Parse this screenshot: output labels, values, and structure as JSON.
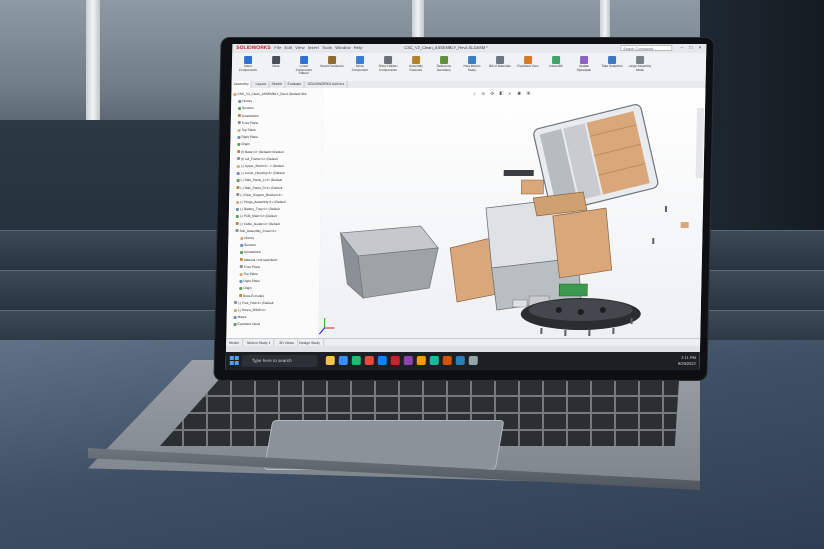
{
  "app": {
    "brand": "SOLIDWORKS",
    "menu": [
      "File",
      "Edit",
      "View",
      "Insert",
      "Tools",
      "Window",
      "Help"
    ],
    "document_title": "CSC_V2_Clean_ASSEMBLY_Rev4.SLDASM *",
    "search_placeholder": "Search Commands",
    "brand_color": "#c0262d"
  },
  "ribbon": {
    "buttons": [
      {
        "label": "Insert Components",
        "color": "#2e6fd8"
      },
      {
        "label": "Mate",
        "color": "#4a4f55"
      },
      {
        "label": "Linear Component Pattern",
        "color": "#2e6fd8"
      },
      {
        "label": "Smart Fasteners",
        "color": "#8f6b2a"
      },
      {
        "label": "Move Component",
        "color": "#3b7ecf"
      },
      {
        "label": "Show Hidden Components",
        "color": "#6a7078"
      },
      {
        "label": "Assembly Features",
        "color": "#b4832e"
      },
      {
        "label": "Reference Geometry",
        "color": "#5f8f3a"
      },
      {
        "label": "New Motion Study",
        "color": "#3c7fbf"
      },
      {
        "label": "Bill of Materials",
        "color": "#6b7580"
      },
      {
        "label": "Exploded View",
        "color": "#d57a1f"
      },
      {
        "label": "Instant3D",
        "color": "#3fa36a"
      },
      {
        "label": "Update Speedpak",
        "color": "#8a63c4"
      },
      {
        "label": "Take Snapshot",
        "color": "#3f79c2"
      },
      {
        "label": "Large Assembly Mode",
        "color": "#7a8089"
      }
    ]
  },
  "tabs": [
    "Assembly",
    "Layout",
    "Sketch",
    "Evaluate",
    "SOLIDWORKS Add-Ins"
  ],
  "tree": {
    "items": [
      "CSC_V2_Clean_ASSEMBLY_Rev4 (Default<Dis",
      "History",
      "Sensors",
      "Annotations",
      "Front Plane",
      "Top Plane",
      "Right Plane",
      "Origin",
      "(f) Base<1> (Default<<Default",
      "(f) Lid_Frame<1> (Default",
      "(-) Upper_Shell<1> -> (Default",
      "(-) Lower_Housing<1> (Default",
      "(-) Side_Panel_L<1> (Default",
      "(-) Side_Panel_R<1> (Default",
      "(-) Rear_Support_Bracket<1>",
      "(-) Hinge_Assembly<1> (Default",
      "(-) Battery_Tray<1> (Default",
      "(-) PCB_Main<1> (Default",
      "(-) Cable_Guide<1> (Default",
      "Sub_Assembly_Cover<1>",
      "History",
      "Sensors",
      "Annotations",
      "Material <not specified>",
      "Front Plane",
      "Top Plane",
      "Right Plane",
      "Origin",
      "Boss-Extrude1",
      "(-) Foot_Pad<1> (Default",
      "(-) Screw_M3x8<1>",
      "Mates",
      "Exploded Views"
    ]
  },
  "viewport": {
    "heads_up_glyphs": "⌕ ⊕ ✥ ◧ ◐ ◉ ▣",
    "background_top": "#ffffff",
    "part_colors": {
      "beige_panels": "#d9a77a",
      "grey_shell": "#a9aeb3",
      "dark_base": "#2a2c30",
      "green_pcb": "#3c9a4e"
    }
  },
  "bottom_tabs": [
    "Model",
    "Motion Study 1",
    "3D Views",
    "Design Study"
  ],
  "taskbar": {
    "search_text": "Type here to search",
    "time": "2:11 PM",
    "date": "9/29/2022",
    "icon_colors": [
      "#f2c14e",
      "#3d8bfd",
      "#2bb673",
      "#e34b3d",
      "#0a84ff",
      "#c0262d",
      "#8e44ad",
      "#f39c12",
      "#1abc9c",
      "#d35400",
      "#2980b9",
      "#95a5a6"
    ]
  }
}
